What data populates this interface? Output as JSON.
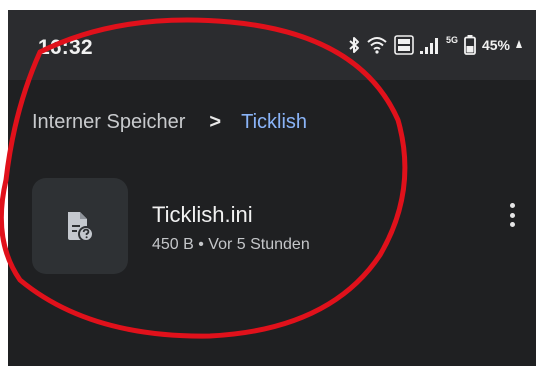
{
  "status_bar": {
    "time": "16:32",
    "network_label": "5G",
    "battery_text": "45%",
    "icons": [
      "bluetooth-icon",
      "wifi-icon",
      "volte-icon",
      "signal-icon",
      "battery-icon",
      "charging-icon"
    ]
  },
  "breadcrumb": {
    "root": "Interner Speicher",
    "separator": ">",
    "current": "Ticklish"
  },
  "file": {
    "name": "Ticklish.ini",
    "meta": "450 B • Vor 5 Stunden",
    "icon": "unknown-file-icon"
  },
  "colors": {
    "background": "#1f2022",
    "status_bar": "#2b2c2f",
    "accent": "#8ab4f8",
    "annotation": "#e0111b"
  }
}
